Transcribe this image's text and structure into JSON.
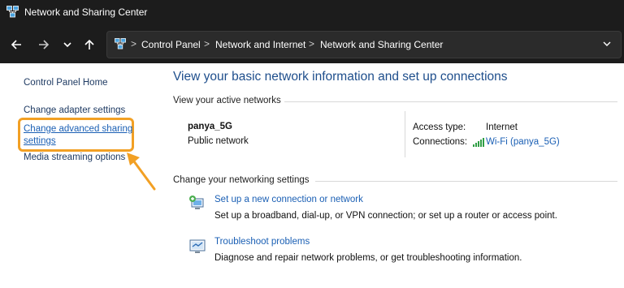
{
  "window": {
    "title": "Network and Sharing Center"
  },
  "navigation": {
    "back_icon": "arrow-left",
    "forward_icon": "arrow-right",
    "recent_icon": "chevron-down",
    "up_icon": "arrow-up"
  },
  "address_bar": {
    "separator": ">",
    "crumbs": [
      "Control Panel",
      "Network and Internet",
      "Network and Sharing Center"
    ],
    "dropdown_icon": "chevron-down"
  },
  "sidebar": {
    "items": [
      {
        "label": "Control Panel Home"
      },
      {
        "label": "Change adapter settings"
      },
      {
        "label_line1": "Change advanced sharing",
        "label_line2": "settings"
      },
      {
        "label": "Media streaming options"
      }
    ],
    "highlight_color": "#f2a024"
  },
  "main": {
    "title": "View your basic network information and set up connections",
    "active_networks": {
      "heading": "View your active networks",
      "network_name": "panya_5G",
      "network_type": "Public network",
      "access_type_label": "Access type:",
      "access_type_value": "Internet",
      "connections_label": "Connections:",
      "connections_value": "Wi-Fi (panya_5G)"
    },
    "networking_settings": {
      "heading": "Change your networking settings",
      "tasks": [
        {
          "link": "Set up a new connection or network",
          "description": "Set up a broadband, dial-up, or VPN connection; or set up a router or access point."
        },
        {
          "link": "Troubleshoot problems",
          "description": "Diagnose and repair network problems, or get troubleshooting information."
        }
      ]
    }
  },
  "colors": {
    "titlebar_bg": "#1c1c1c",
    "link": "#1a5fb4",
    "heading": "#1e4e8c"
  }
}
